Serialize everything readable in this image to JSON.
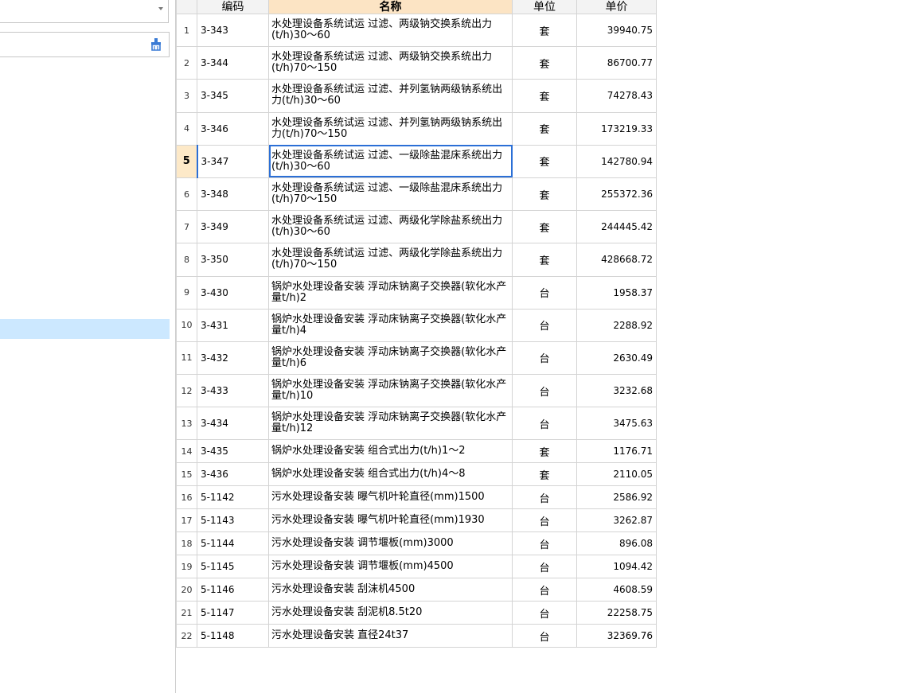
{
  "search": {
    "value": "",
    "placeholder": ""
  },
  "grid": {
    "headers": {
      "code": "编码",
      "name": "名称",
      "unit": "单位",
      "price": "单价"
    },
    "selected_row": 5,
    "rows": [
      {
        "index": "1",
        "code": "3-343",
        "name": "水处理设备系统试运 过滤、两级钠交换系统出力(t/h)30～60",
        "unit": "套",
        "price": "39940.75"
      },
      {
        "index": "2",
        "code": "3-344",
        "name": "水处理设备系统试运 过滤、两级钠交换系统出力(t/h)70～150",
        "unit": "套",
        "price": "86700.77"
      },
      {
        "index": "3",
        "code": "3-345",
        "name": "水处理设备系统试运 过滤、并列氢钠两级钠系统出力(t/h)30～60",
        "unit": "套",
        "price": "74278.43"
      },
      {
        "index": "4",
        "code": "3-346",
        "name": "水处理设备系统试运 过滤、并列氢钠两级钠系统出力(t/h)70～150",
        "unit": "套",
        "price": "173219.33"
      },
      {
        "index": "5",
        "code": "3-347",
        "name": "水处理设备系统试运 过滤、一级除盐混床系统出力(t/h)30～60",
        "unit": "套",
        "price": "142780.94"
      },
      {
        "index": "6",
        "code": "3-348",
        "name": "水处理设备系统试运 过滤、一级除盐混床系统出力(t/h)70～150",
        "unit": "套",
        "price": "255372.36"
      },
      {
        "index": "7",
        "code": "3-349",
        "name": "水处理设备系统试运 过滤、两级化学除盐系统出力(t/h)30～60",
        "unit": "套",
        "price": "244445.42"
      },
      {
        "index": "8",
        "code": "3-350",
        "name": "水处理设备系统试运 过滤、两级化学除盐系统出力(t/h)70～150",
        "unit": "套",
        "price": "428668.72"
      },
      {
        "index": "9",
        "code": "3-430",
        "name": "锅炉水处理设备安装 浮动床钠离子交换器(软化水产量t/h)2",
        "unit": "台",
        "price": "1958.37"
      },
      {
        "index": "10",
        "code": "3-431",
        "name": "锅炉水处理设备安装 浮动床钠离子交换器(软化水产量t/h)4",
        "unit": "台",
        "price": "2288.92"
      },
      {
        "index": "11",
        "code": "3-432",
        "name": "锅炉水处理设备安装 浮动床钠离子交换器(软化水产量t/h)6",
        "unit": "台",
        "price": "2630.49"
      },
      {
        "index": "12",
        "code": "3-433",
        "name": "锅炉水处理设备安装 浮动床钠离子交换器(软化水产量t/h)10",
        "unit": "台",
        "price": "3232.68"
      },
      {
        "index": "13",
        "code": "3-434",
        "name": "锅炉水处理设备安装 浮动床钠离子交换器(软化水产量t/h)12",
        "unit": "台",
        "price": "3475.63"
      },
      {
        "index": "14",
        "code": "3-435",
        "name": "锅炉水处理设备安装 组合式出力(t/h)1～2",
        "unit": "套",
        "price": "1176.71"
      },
      {
        "index": "15",
        "code": "3-436",
        "name": "锅炉水处理设备安装 组合式出力(t/h)4～8",
        "unit": "套",
        "price": "2110.05"
      },
      {
        "index": "16",
        "code": "5-1142",
        "name": "污水处理设备安装 曝气机叶轮直径(mm)1500",
        "unit": "台",
        "price": "2586.92"
      },
      {
        "index": "17",
        "code": "5-1143",
        "name": "污水处理设备安装 曝气机叶轮直径(mm)1930",
        "unit": "台",
        "price": "3262.87"
      },
      {
        "index": "18",
        "code": "5-1144",
        "name": "污水处理设备安装 调节堰板(mm)3000",
        "unit": "台",
        "price": "896.08"
      },
      {
        "index": "19",
        "code": "5-1145",
        "name": "污水处理设备安装 调节堰板(mm)4500",
        "unit": "台",
        "price": "1094.42"
      },
      {
        "index": "20",
        "code": "5-1146",
        "name": "污水处理设备安装 刮沫机4500",
        "unit": "台",
        "price": "4608.59"
      },
      {
        "index": "21",
        "code": "5-1147",
        "name": "污水处理设备安装 刮泥机8.5t20",
        "unit": "台",
        "price": "22258.75"
      },
      {
        "index": "22",
        "code": "5-1148",
        "name": "污水处理设备安装 直径24t37",
        "unit": "台",
        "price": "32369.76"
      }
    ]
  },
  "colors": {
    "selection_border": "#2b6fd6",
    "tree_selected": "#cce8ff",
    "name_header": "#fce4c4",
    "current_index": "#fde9c8",
    "clear_icon": "#3a7bd5"
  },
  "icons": {
    "dropdown": "chevron-down-icon",
    "clear": "clear-brush-icon"
  }
}
